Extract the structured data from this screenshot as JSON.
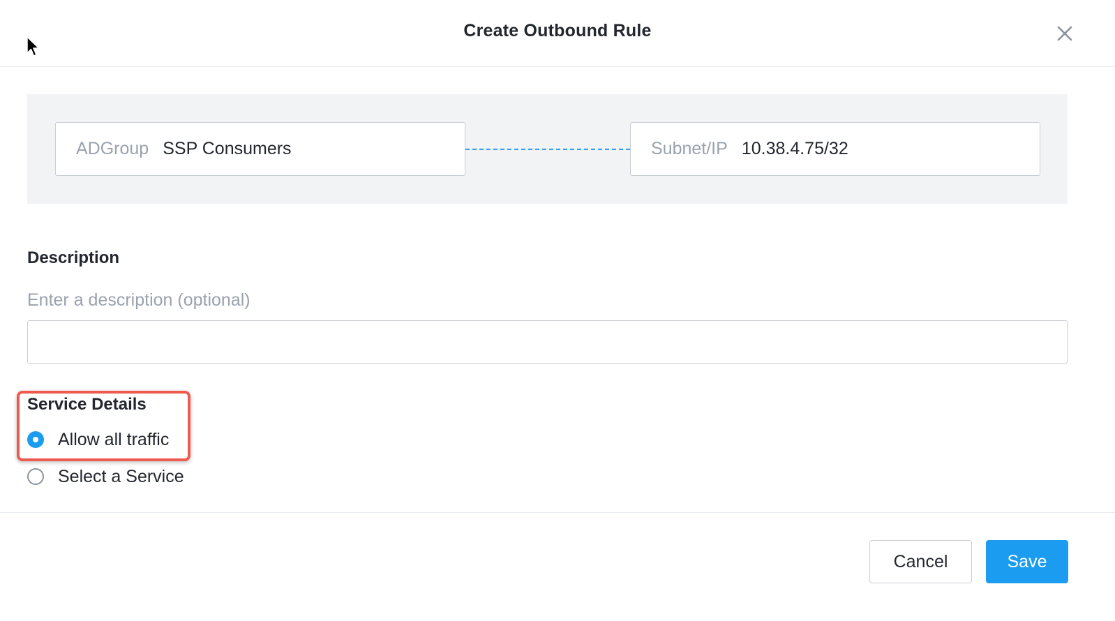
{
  "dialog": {
    "title": "Create Outbound Rule",
    "close_icon": "close-icon"
  },
  "flow": {
    "source": {
      "type": "ADGroup",
      "value": "SSP Consumers"
    },
    "target": {
      "type": "Subnet/IP",
      "value": "10.38.4.75/32"
    },
    "connector_color": "#2fa0f0"
  },
  "description": {
    "label": "Description",
    "hint": "Enter a description (optional)",
    "value": ""
  },
  "service_details": {
    "label": "Service Details",
    "options": [
      {
        "label": "Allow all traffic",
        "selected": true
      },
      {
        "label": "Select a Service",
        "selected": false
      }
    ]
  },
  "footer": {
    "cancel_label": "Cancel",
    "save_label": "Save"
  },
  "colors": {
    "accent": "#1b9cf0",
    "highlight": "#ef5a4f"
  }
}
